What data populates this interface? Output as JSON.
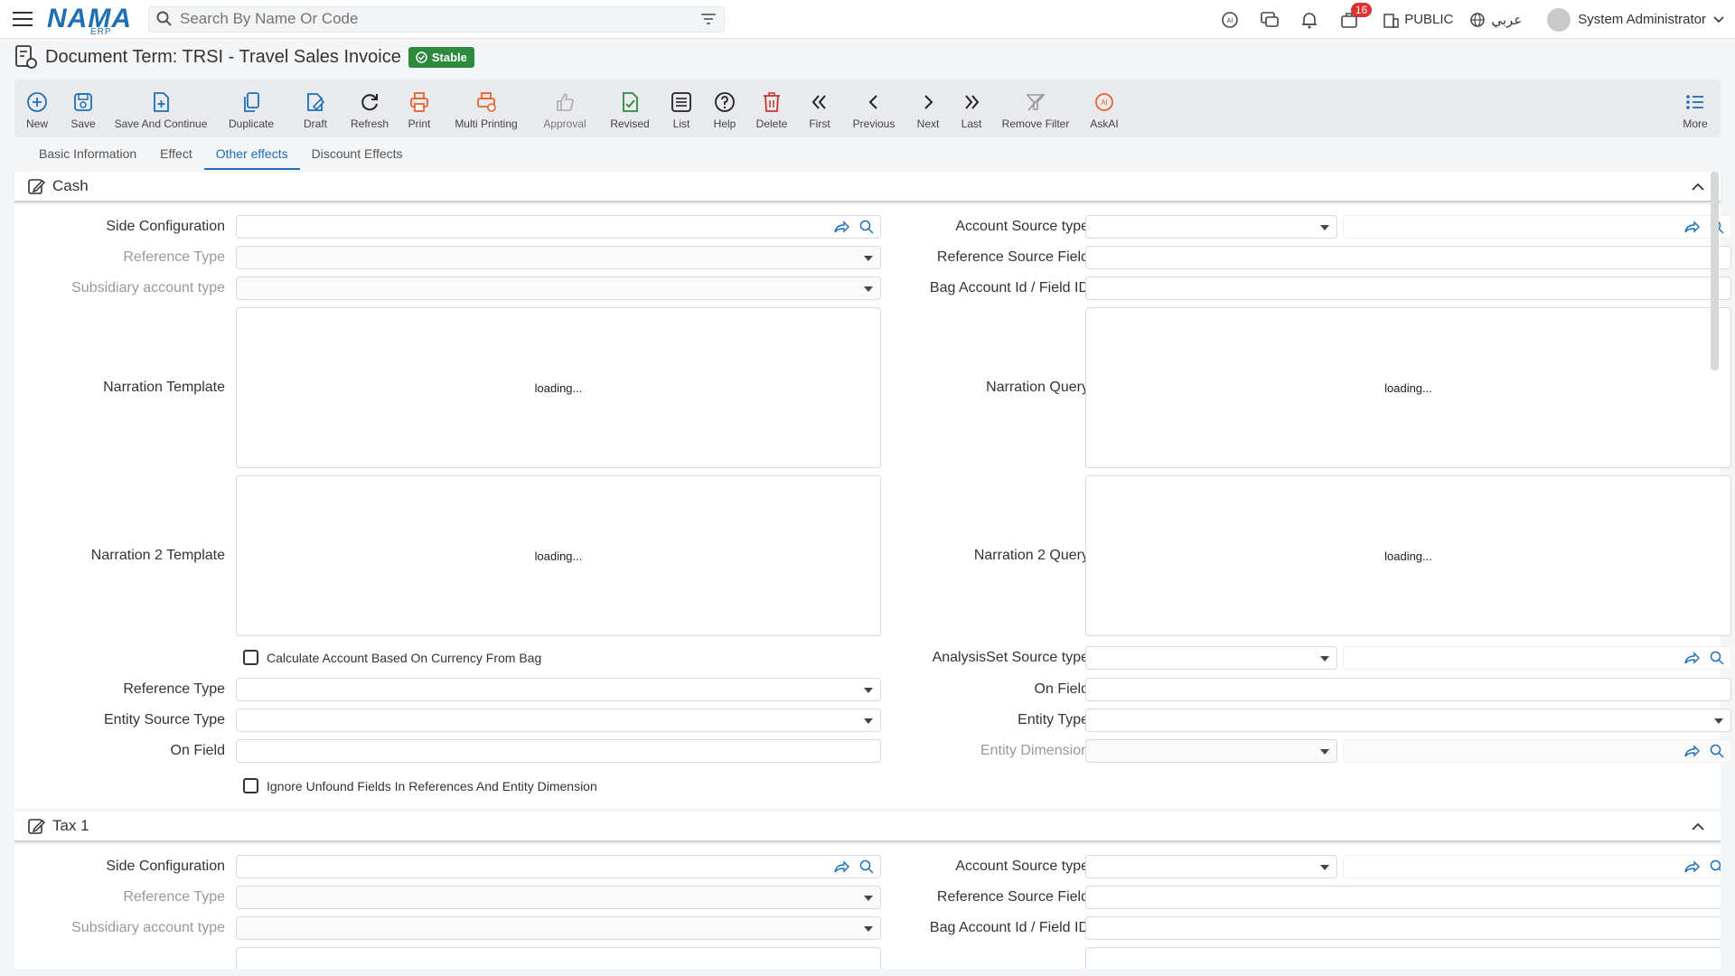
{
  "app": {
    "logo": "NAMA",
    "logo_sub": "ERP"
  },
  "search": {
    "placeholder": "Search By Name Or Code"
  },
  "topbar": {
    "notifications_count": "16",
    "public_label": "PUBLIC",
    "language_label": "عربي",
    "user_name": "System Administrator"
  },
  "page": {
    "title": "Document Term: TRSI - Travel Sales Invoice",
    "status": "Stable"
  },
  "toolbar": {
    "new": "New",
    "save": "Save",
    "save_continue": "Save And Continue",
    "duplicate": "Duplicate",
    "draft": "Draft",
    "refresh": "Refresh",
    "print": "Print",
    "multi_printing": "Multi Printing",
    "approval": "Approval",
    "revised": "Revised",
    "list": "List",
    "help": "Help",
    "delete": "Delete",
    "first": "First",
    "previous": "Previous",
    "next": "Next",
    "last": "Last",
    "remove_filter": "Remove Filter",
    "askai": "AskAI",
    "more": "More"
  },
  "tabs": [
    "Basic Information",
    "Effect",
    "Other effects",
    "Discount Effects"
  ],
  "cash": {
    "title": "Cash",
    "side_configuration": "Side Configuration",
    "reference_type": "Reference Type",
    "subsidiary_account_type": "Subsidiary account type",
    "narration_template": "Narration Template",
    "narration2_template": "Narration 2 Template",
    "loading": "loading...",
    "calc_account_currency": "Calculate Account Based On Currency From Bag",
    "reference_type2": "Reference Type",
    "entity_source_type": "Entity Source Type",
    "on_field": "On Field",
    "ignore_unfound": "Ignore Unfound Fields In References And Entity Dimension",
    "account_source_type": "Account Source type",
    "reference_source_field": "Reference Source Field",
    "bag_account_id": "Bag Account Id / Field ID",
    "narration_query": "Narration Query",
    "narration2_query": "Narration 2 Query",
    "analysisset_source_type": "AnalysisSet Source type",
    "on_field_right": "On Field",
    "entity_type": "Entity Type",
    "entity_dimension": "Entity Dimension"
  },
  "tax1": {
    "title": "Tax 1",
    "side_configuration": "Side Configuration",
    "reference_type": "Reference Type",
    "subsidiary_account_type": "Subsidiary account type",
    "account_source_type": "Account Source type",
    "reference_source_field": "Reference Source Field",
    "bag_account_id": "Bag Account Id / Field ID"
  }
}
